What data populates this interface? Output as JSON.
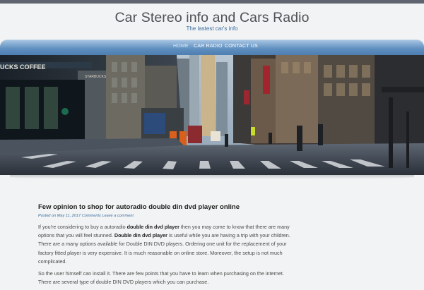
{
  "site": {
    "title": "Car Stereo info and Cars Radio",
    "tagline": "The lastest car's info"
  },
  "nav": {
    "items": [
      {
        "label": "HOME",
        "active": true
      },
      {
        "label": "CAR RADIO",
        "active": false
      },
      {
        "label": "CONTACT US",
        "active": false
      }
    ]
  },
  "banner": {
    "storefront_sign": "UCKS COFFEE",
    "storefront_sign_2": "STARBUCKS"
  },
  "post": {
    "title": "Few opinion to shop for autoradio double din dvd player online",
    "meta": {
      "posted_on_label": "Posted on",
      "date": "May 11, 2017",
      "comments_label": "Comments",
      "comment_link": "Leave a comment"
    },
    "paragraph1": {
      "t1": "If you're considering to buy a autoradio ",
      "b1": "double din dvd player",
      "t2": " then you may come to know that there are many options that you will feel stunned. ",
      "b2": "Double din dvd player",
      "t3": " is useful while you are having a trip with your children. There are a many options available for Double DIN DVD players. Ordering one unit for the replacement of your factory fitted player is very expensive. It is much reasonable on online store. Moreover, the setup is not much complicated."
    },
    "paragraph2": "So the user himself can install it. There are few points that you have to learn when purchasing on the internet. There are several type of double DIN DVD players which you can purchase."
  },
  "colors": {
    "nav_gradient_top": "#a6c4e1",
    "nav_gradient_bottom": "#4c7cae",
    "link_blue": "#3a6ea0",
    "page_bg": "#f2f3f4"
  }
}
